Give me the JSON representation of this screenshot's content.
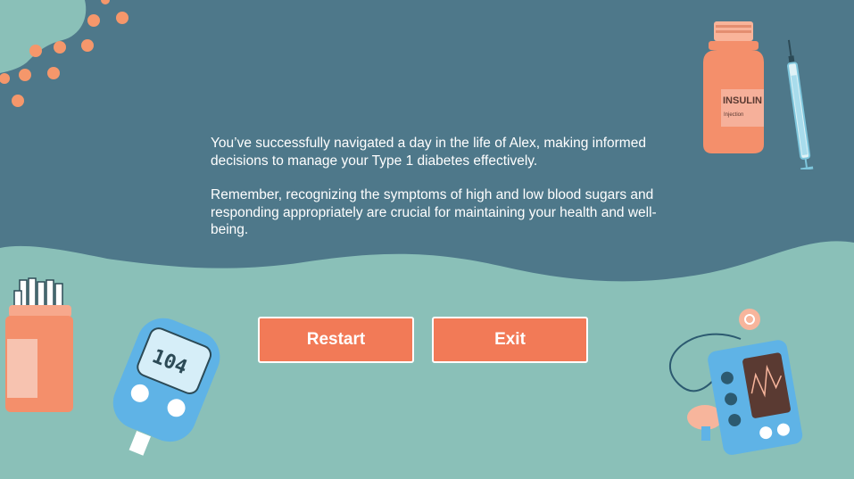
{
  "message": {
    "paragraph_1": "You’ve successfully navigated a day in the life of Alex, making informed decisions to manage your Type 1 diabetes effectively.",
    "paragraph_2": "Remember, recognizing the symptoms of high and low blood sugars and responding appropriately are crucial for maintaining your health and well-being."
  },
  "buttons": {
    "restart_label": "Restart",
    "exit_label": "Exit"
  },
  "illustrations": {
    "insulin_bottle_label": "INSULIN",
    "insulin_bottle_sublabel": "Injection",
    "glucose_meter_reading": "104"
  },
  "colors": {
    "top_background": "#4e788a",
    "bottom_background": "#8ac0b8",
    "accent": "#f27a57",
    "dots": "#f5976b"
  }
}
